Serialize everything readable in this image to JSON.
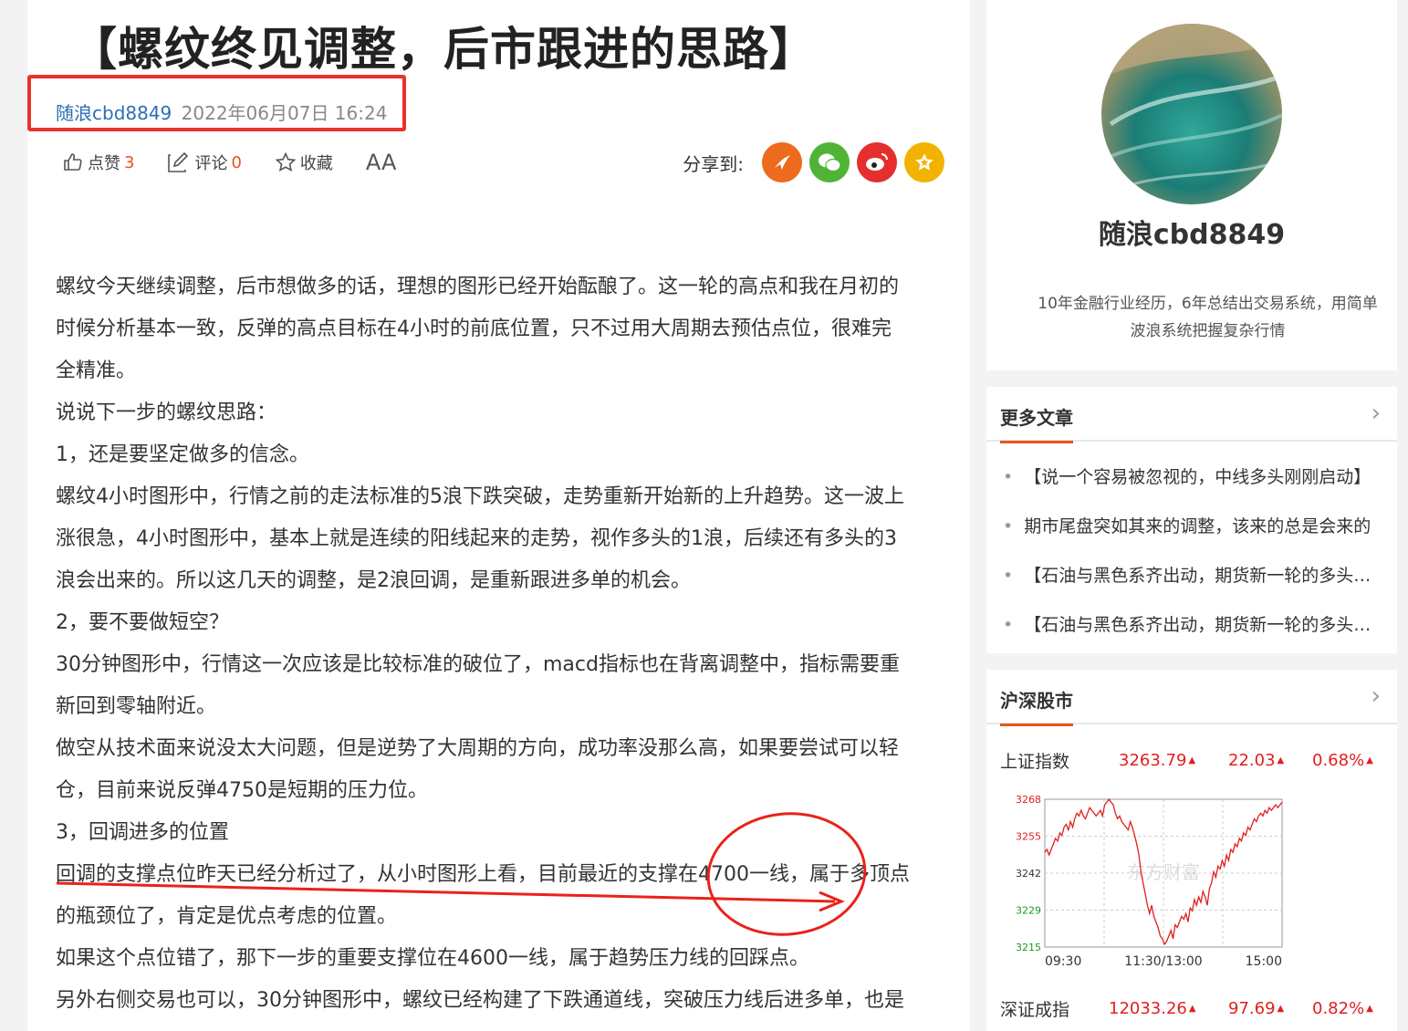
{
  "article": {
    "title": "【螺纹终见调整，后市跟进的思路】",
    "author": "随浪cbd8849",
    "datetime": "2022年06月07日 16:24",
    "actions": {
      "like_label": "点赞",
      "like_count": "3",
      "comment_label": "评论",
      "comment_count": "0",
      "favorite_label": "收藏",
      "font_label": "AA"
    },
    "share": {
      "label": "分享到:",
      "icons": [
        "dongfang-icon",
        "wechat-icon",
        "weibo-icon",
        "favorite-star-icon"
      ]
    },
    "paragraphs": [
      "螺纹今天继续调整，后市想做多的话，理想的图形已经开始酝酿了。这一轮的高点和我在月初的",
      "时候分析基本一致，反弹的高点目标在4小时的前底位置，只不过用大周期去预估点位，很难完",
      "全精准。",
      "说说下一步的螺纹思路：",
      "1，还是要坚定做多的信念。",
      "螺纹4小时图形中，行情之前的走法标准的5浪下跌突破，走势重新开始新的上升趋势。这一波上",
      "涨很急，4小时图形中，基本上就是连续的阳线起来的走势，视作多头的1浪，后续还有多头的3",
      "浪会出来的。所以这几天的调整，是2浪回调，是重新跟进多单的机会。",
      "2，要不要做短空？",
      "30分钟图形中，行情这一次应该是比较标准的破位了，macd指标也在背离调整中，指标需要重",
      "新回到零轴附近。",
      "做空从技术面来说没太大问题，但是逆势了大周期的方向，成功率没那么高，如果要尝试可以轻",
      "仓，目前来说反弹4750是短期的压力位。",
      "3，回调进多的位置",
      "回调的支撑点位昨天已经分析过了，从小时图形上看，目前最近的支撑在4700一线，属于多顶点",
      "的瓶颈位了，肯定是优点考虑的位置。",
      "如果这个点位错了，那下一步的重要支撑位在4600一线，属于趋势压力线的回踩点。",
      "另外右侧交易也可以，30分钟图形中，螺纹已经构建了下跌通道线，突破压力线后进多单，也是"
    ]
  },
  "profile": {
    "name": "随浪cbd8849",
    "description": "10年金融行业经历，6年总结出交易系统，用简单波浪系统把握复杂行情"
  },
  "more_articles": {
    "title": "更多文章",
    "items": [
      "【说一个容易被忽视的，中线多头刚刚启动】",
      "期市尾盘突如其来的调整，该来的总是会来的",
      "【石油与黑色系齐出动，期货新一轮的多头行情】",
      "【石油与黑色系齐出动，期货新一轮的多头行情】"
    ]
  },
  "market": {
    "title": "沪深股市",
    "rows": [
      {
        "name": "上证指数",
        "price": "3263.79",
        "change": "22.03",
        "pct": "0.68%"
      },
      {
        "name": "深证成指",
        "price": "12033.26",
        "change": "97.69",
        "pct": "0.82%"
      }
    ],
    "up_color": "#e02020"
  },
  "chart_data": {
    "type": "line",
    "series": [
      {
        "values": [
          3249,
          3250,
          3248,
          3250,
          3252,
          3254,
          3253,
          3256,
          3255,
          3258,
          3259,
          3257,
          3260,
          3258,
          3261,
          3263,
          3262,
          3264,
          3262,
          3261,
          3263,
          3265,
          3264,
          3263,
          3262,
          3263,
          3264,
          3262,
          3266,
          3267,
          3268,
          3267,
          3266,
          3263,
          3261,
          3262,
          3260,
          3259,
          3258,
          3257,
          3260,
          3258,
          3255,
          3252,
          3248,
          3242,
          3238,
          3234,
          3230,
          3227,
          3230,
          3226,
          3224,
          3222,
          3219,
          3218,
          3216,
          3217,
          3219,
          3221,
          3218,
          3223,
          3222,
          3224,
          3226,
          3225,
          3227,
          3224,
          3229,
          3228,
          3232,
          3230,
          3233,
          3231,
          3235,
          3233,
          3230,
          3236,
          3238,
          3242,
          3240,
          3244,
          3243,
          3246,
          3244,
          3248,
          3246,
          3250,
          3249,
          3252,
          3251,
          3254,
          3253,
          3256,
          3255,
          3258,
          3257,
          3259,
          3261,
          3260,
          3262,
          3263,
          3262,
          3264,
          3263,
          3265,
          3264,
          3265,
          3266,
          3265,
          3266,
          3267
        ]
      }
    ],
    "yticks": [
      "3268",
      "3255",
      "3242",
      "3229",
      "3215"
    ],
    "xticks": [
      "09:30",
      "11:30/13:00",
      "15:00"
    ],
    "ylim": [
      3215,
      3268
    ],
    "grid": true,
    "line_color": "#e02020",
    "watermark": "东方财富"
  }
}
